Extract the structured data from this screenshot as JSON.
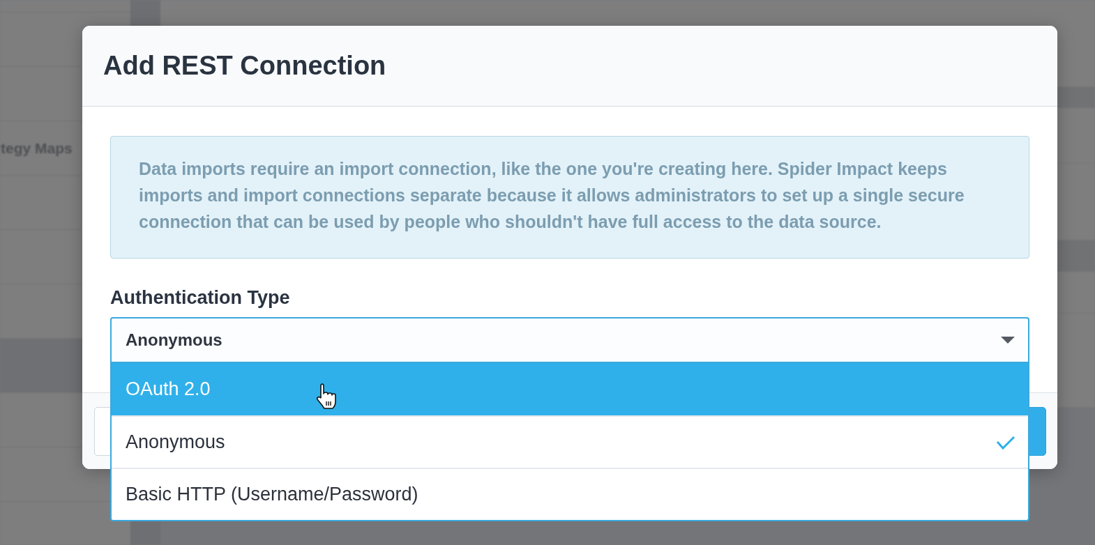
{
  "background": {
    "sidebar_label": "tegy Maps"
  },
  "dialog": {
    "title": "Add REST Connection",
    "info_text": "Data imports require an import connection, like the one you're creating here. Spider Impact keeps imports and import connections separate because it allows administrators to set up a single secure connection that can be used by people who shouldn't have full access to the data source.",
    "field": {
      "label": "Authentication Type",
      "value": "Anonymous",
      "expanded": true,
      "options": [
        {
          "label": "OAuth 2.0",
          "hovered": true,
          "selected": false
        },
        {
          "label": "Anonymous",
          "hovered": false,
          "selected": true
        },
        {
          "label": "Basic HTTP (Username/Password)",
          "hovered": false,
          "selected": false
        }
      ]
    },
    "footer_buttons": [
      {
        "kind": "secondary"
      },
      {
        "kind": "primary"
      }
    ]
  }
}
